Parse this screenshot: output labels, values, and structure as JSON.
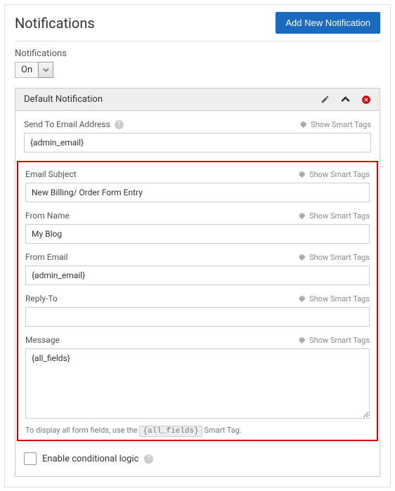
{
  "header": {
    "title": "Notifications",
    "add_button": "Add New Notification"
  },
  "toggle": {
    "label": "Notifications",
    "value": "On"
  },
  "panel": {
    "title": "Default Notification",
    "smart_tags_label": "Show Smart Tags",
    "fields": {
      "send_to": {
        "label": "Send To Email Address",
        "value": "{admin_email}"
      },
      "subject": {
        "label": "Email Subject",
        "value": "New Billing/ Order Form Entry"
      },
      "from_name": {
        "label": "From Name",
        "value": "My Blog"
      },
      "from_email": {
        "label": "From Email",
        "value": "{admin_email}"
      },
      "reply_to": {
        "label": "Reply-To",
        "value": ""
      },
      "message": {
        "label": "Message",
        "value": "{all_fields}"
      }
    },
    "hint": {
      "prefix": "To display all form fields, use the ",
      "chip": "{all_fields}",
      "suffix": " Smart Tag."
    },
    "conditional": {
      "label": "Enable conditional logic"
    }
  }
}
